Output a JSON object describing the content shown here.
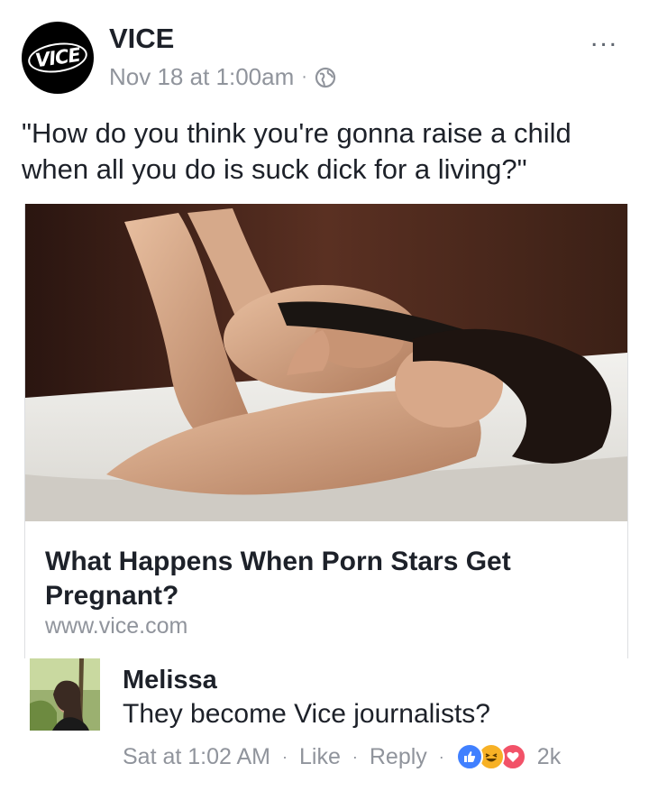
{
  "post": {
    "page_name": "VICE",
    "avatar_logo_text": "VICE",
    "timestamp": "Nov 18 at 1:00am",
    "meta_separator": "·",
    "privacy_icon": "globe-icon",
    "more_icon": "more-options-icon",
    "more_glyph": "...",
    "text": "\"How do you think you're gonna raise a child when all you do is suck dick for a living?\""
  },
  "link_preview": {
    "title": "What Happens When Porn Stars Get Pregnant?",
    "domain": "www.vice.com"
  },
  "comment": {
    "author": "Melissa",
    "text": "They become Vice journalists?",
    "time": "Sat at 1:02 AM",
    "separator": "·",
    "like_label": "Like",
    "reply_label": "Reply",
    "reactions": [
      "like",
      "haha",
      "love"
    ],
    "reaction_count": "2k"
  },
  "colors": {
    "text_primary": "#1d2129",
    "text_secondary": "#90949c",
    "like_blue": "#4080ff",
    "haha_yellow": "#f7b125",
    "love_red": "#f25268"
  }
}
